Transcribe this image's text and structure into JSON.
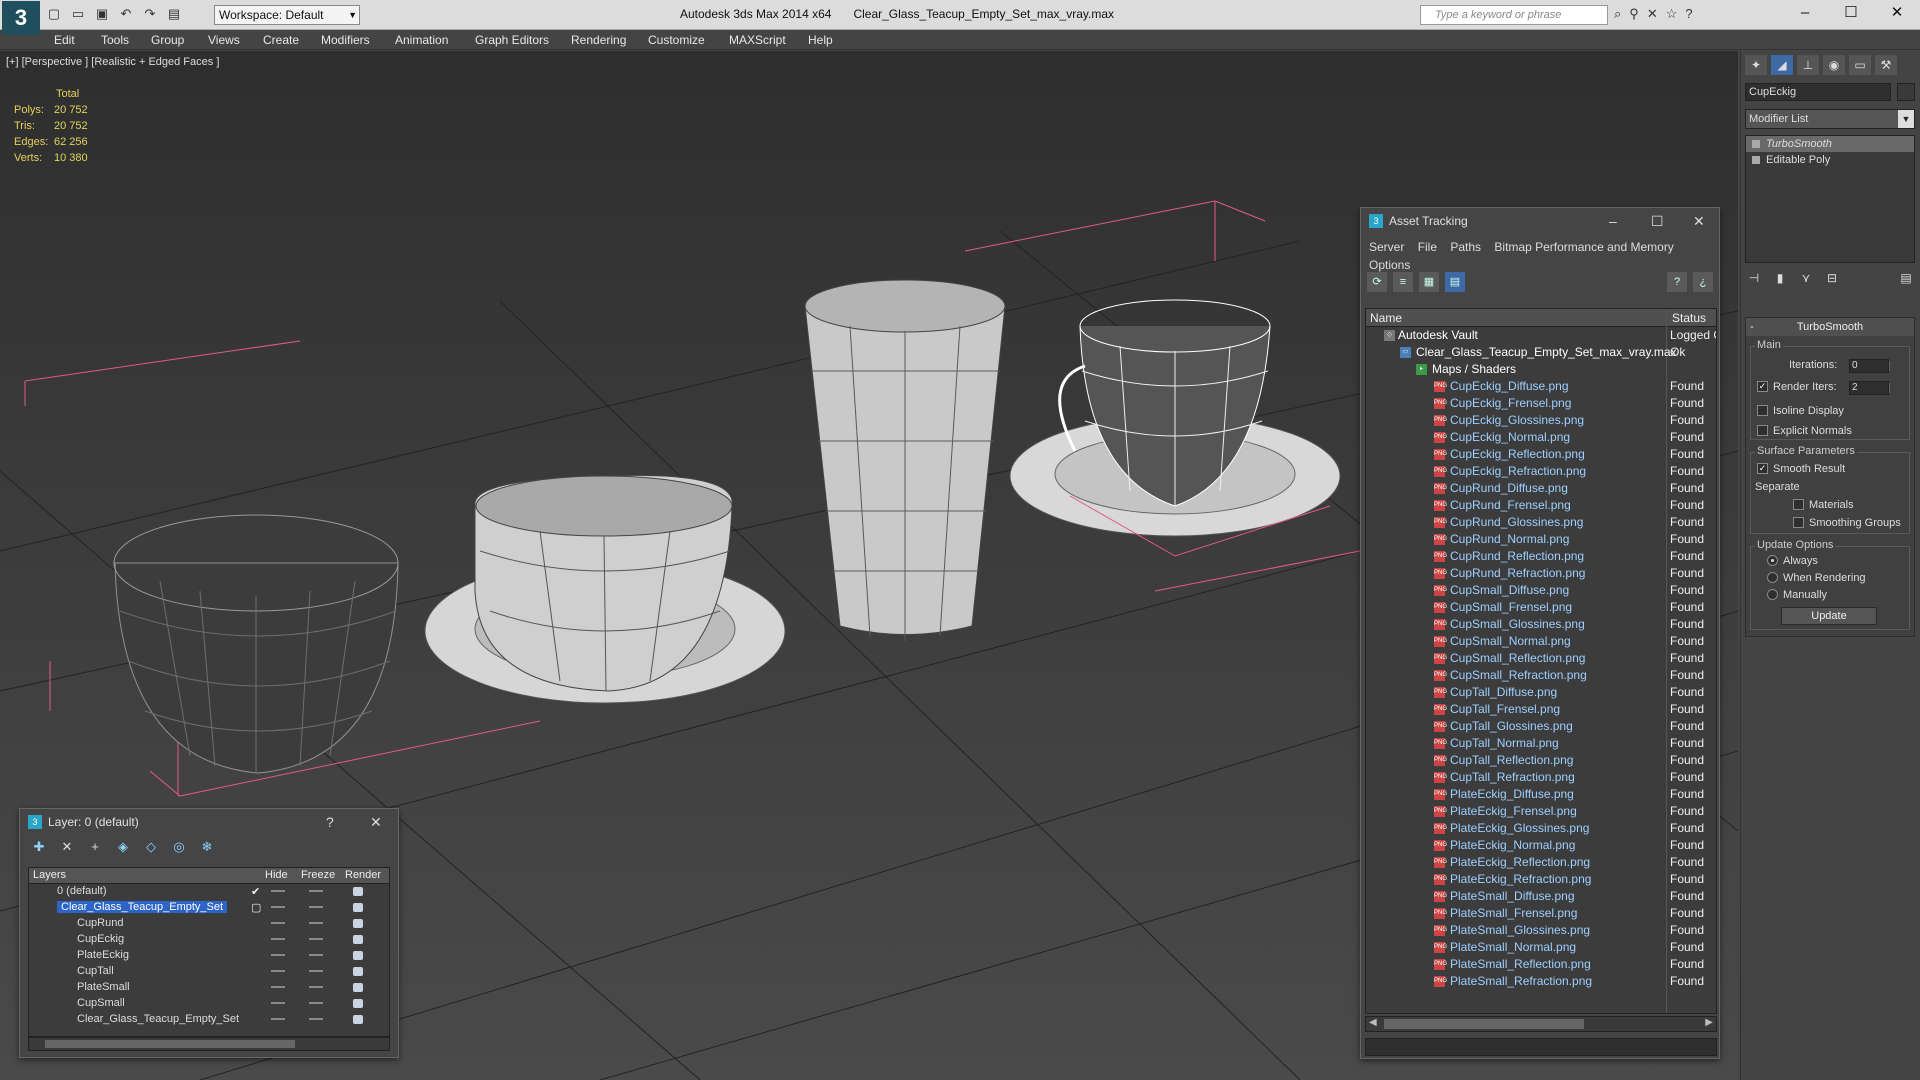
{
  "app": {
    "title": "Autodesk 3ds Max  2014 x64",
    "file": "Clear_Glass_Teacup_Empty_Set_max_vray.max",
    "workspace": "Workspace: Default",
    "search_placeholder": "Type a keyword or phrase"
  },
  "menu": [
    "Edit",
    "Tools",
    "Group",
    "Views",
    "Create",
    "Modifiers",
    "Animation",
    "Graph Editors",
    "Rendering",
    "Customize",
    "MAXScript",
    "Help"
  ],
  "viewport": {
    "label": "[+] [Perspective ] [Realistic + Edged Faces ]",
    "stats": {
      "header": "Total",
      "rows": [
        {
          "label": "Polys:",
          "value": "20 752"
        },
        {
          "label": "Tris:",
          "value": "20 752"
        },
        {
          "label": "Edges:",
          "value": "62 256"
        },
        {
          "label": "Verts:",
          "value": "10 380"
        }
      ]
    }
  },
  "asset_tracking": {
    "title": "Asset Tracking",
    "menu": [
      "Server",
      "File",
      "Paths",
      "Bitmap Performance and Memory"
    ],
    "menu2": "Options",
    "col_name": "Name",
    "col_status": "Status",
    "vault": {
      "name": "Autodesk Vault",
      "status": "Logged O"
    },
    "file": {
      "name": "Clear_Glass_Teacup_Empty_Set_max_vray.max",
      "status": "Ok"
    },
    "folder": "Maps / Shaders",
    "maps": [
      "CupEckig_Diffuse.png",
      "CupEckig_Frensel.png",
      "CupEckig_Glossines.png",
      "CupEckig_Normal.png",
      "CupEckig_Reflection.png",
      "CupEckig_Refraction.png",
      "CupRund_Diffuse.png",
      "CupRund_Frensel.png",
      "CupRund_Glossines.png",
      "CupRund_Normal.png",
      "CupRund_Reflection.png",
      "CupRund_Refraction.png",
      "CupSmall_Diffuse.png",
      "CupSmall_Frensel.png",
      "CupSmall_Glossines.png",
      "CupSmall_Normal.png",
      "CupSmall_Reflection.png",
      "CupSmall_Refraction.png",
      "CupTall_Diffuse.png",
      "CupTall_Frensel.png",
      "CupTall_Glossines.png",
      "CupTall_Normal.png",
      "CupTall_Reflection.png",
      "CupTall_Refraction.png",
      "PlateEckig_Diffuse.png",
      "PlateEckig_Frensel.png",
      "PlateEckig_Glossines.png",
      "PlateEckig_Normal.png",
      "PlateEckig_Reflection.png",
      "PlateEckig_Refraction.png",
      "PlateSmall_Diffuse.png",
      "PlateSmall_Frensel.png",
      "PlateSmall_Glossines.png",
      "PlateSmall_Normal.png",
      "PlateSmall_Reflection.png",
      "PlateSmall_Refraction.png"
    ],
    "map_status": "Found"
  },
  "layer_panel": {
    "title": "Layer: 0 (default)",
    "help": "?",
    "cols": {
      "layers": "Layers",
      "hide": "Hide",
      "freeze": "Freeze",
      "render": "Render"
    },
    "rows": [
      {
        "name": "0 (default)",
        "indent": 16,
        "sel": false,
        "check": "✔"
      },
      {
        "name": "Clear_Glass_Teacup_Empty_Set",
        "indent": 16,
        "sel": true,
        "check": "▢"
      },
      {
        "name": "CupRund",
        "indent": 36,
        "sel": false,
        "check": ""
      },
      {
        "name": "CupEckig",
        "indent": 36,
        "sel": false,
        "check": ""
      },
      {
        "name": "PlateEckig",
        "indent": 36,
        "sel": false,
        "check": ""
      },
      {
        "name": "CupTall",
        "indent": 36,
        "sel": false,
        "check": ""
      },
      {
        "name": "PlateSmall",
        "indent": 36,
        "sel": false,
        "check": ""
      },
      {
        "name": "CupSmall",
        "indent": 36,
        "sel": false,
        "check": ""
      },
      {
        "name": "Clear_Glass_Teacup_Empty_Set",
        "indent": 36,
        "sel": false,
        "check": ""
      }
    ]
  },
  "command_panel": {
    "object_name": "CupEckig",
    "modifier_list": "Modifier List",
    "stack": [
      "TurboSmooth",
      "Editable Poly"
    ],
    "rollout": "TurboSmooth",
    "main": "Main",
    "iterations_label": "Iterations:",
    "iterations": "0",
    "render_iters_label": "Render Iters:",
    "render_iters": "2",
    "isoline": "Isoline Display",
    "explicit": "Explicit Normals",
    "surface": "Surface Parameters",
    "smooth_result": "Smooth Result",
    "separate": "Separate",
    "materials": "Materials",
    "smoothing_groups": "Smoothing Groups",
    "update_options": "Update Options",
    "always": "Always",
    "when_rendering": "When Rendering",
    "manually": "Manually",
    "update": "Update"
  }
}
